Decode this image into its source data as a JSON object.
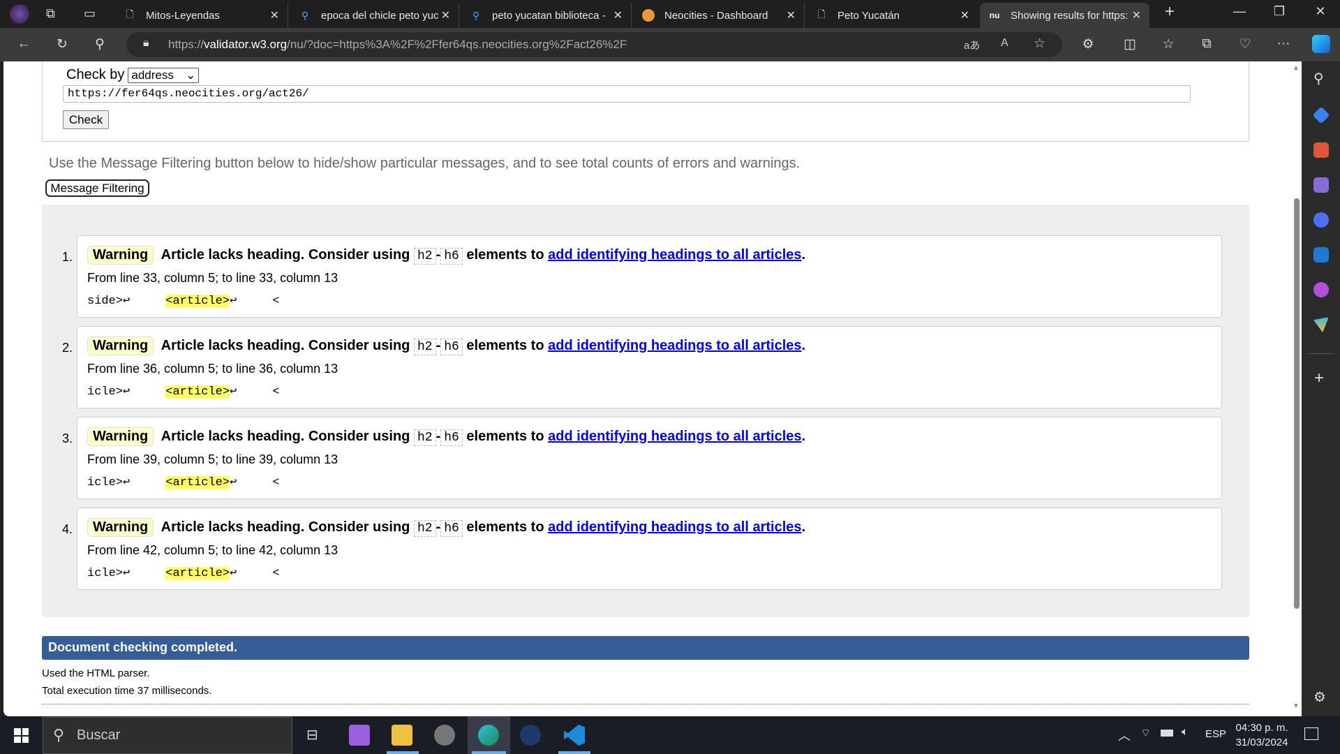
{
  "browser": {
    "tabs": [
      {
        "label": "Mitos-Leyendas",
        "icon": "page-icon"
      },
      {
        "label": "epoca del chicle peto yuc",
        "icon": "search-icon"
      },
      {
        "label": "peto yucatan biblioteca -",
        "icon": "search-icon"
      },
      {
        "label": "Neocities - Dashboard",
        "icon": "neocities-cat-icon"
      },
      {
        "label": "Peto Yucatán",
        "icon": "page-icon"
      },
      {
        "label": "Showing results for https:",
        "icon": "nu-validator-icon",
        "active": true
      }
    ],
    "favicon_text": "nu",
    "url_prefix": "https://",
    "url_domain": "validator.w3.org",
    "url_rest": "/nu/?doc=https%3A%2F%2Ffer64qs.neocities.org%2Fact26%2F"
  },
  "form": {
    "check_by_label": "Check by",
    "check_by_value": "address",
    "url_value": "https://fer64qs.neocities.org/act26/",
    "check_button": "Check"
  },
  "info_text": "Use the Message Filtering button below to hide/show particular messages, and to see total counts of errors and warnings.",
  "filter_button": "Message Filtering",
  "messages": [
    {
      "num": "1.",
      "type": "Warning",
      "text": "Article lacks heading. Consider using",
      "code1": "h2",
      "dash": "-",
      "code2": "h6",
      "text2": "elements to",
      "link": "add identifying headings to all articles",
      "end": ".",
      "location": "From line 33, column 5; to line 33, column 13",
      "extract_pre": "side>↩     ",
      "extract_hl": "<article>",
      "extract_post": "↩     <"
    },
    {
      "num": "2.",
      "type": "Warning",
      "text": "Article lacks heading. Consider using",
      "code1": "h2",
      "dash": "-",
      "code2": "h6",
      "text2": "elements to",
      "link": "add identifying headings to all articles",
      "end": ".",
      "location": "From line 36, column 5; to line 36, column 13",
      "extract_pre": "icle>↩     ",
      "extract_hl": "<article>",
      "extract_post": "↩     <"
    },
    {
      "num": "3.",
      "type": "Warning",
      "text": "Article lacks heading. Consider using",
      "code1": "h2",
      "dash": "-",
      "code2": "h6",
      "text2": "elements to",
      "link": "add identifying headings to all articles",
      "end": ".",
      "location": "From line 39, column 5; to line 39, column 13",
      "extract_pre": "icle>↩     ",
      "extract_hl": "<article>",
      "extract_post": "↩     <"
    },
    {
      "num": "4.",
      "type": "Warning",
      "text": "Article lacks heading. Consider using",
      "code1": "h2",
      "dash": "-",
      "code2": "h6",
      "text2": "elements to",
      "link": "add identifying headings to all articles",
      "end": ".",
      "location": "From line 42, column 5; to line 42, column 13",
      "extract_pre": "icle>↩     ",
      "extract_hl": "<article>",
      "extract_post": "↩     <"
    }
  ],
  "completed": "Document checking completed.",
  "parser": "Used the HTML parser.",
  "exec_time": "Total execution time 37 milliseconds.",
  "taskbar": {
    "search_placeholder": "Buscar",
    "lang": "ESP",
    "time": "04:30 p. m.",
    "date": "31/03/2024"
  },
  "colors": {
    "completed_bar": "#365d95",
    "warning_bg": "#ffffcc",
    "link": "#0000ee"
  }
}
